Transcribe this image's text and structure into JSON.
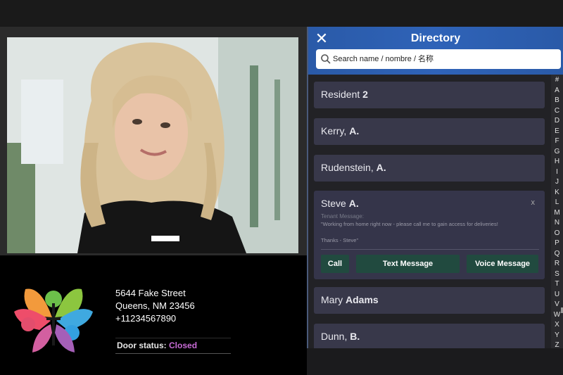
{
  "video": {
    "subject": "resident-camera-feed"
  },
  "info": {
    "address_line1": "5644 Fake Street",
    "address_line2": "Queens, NM 23456",
    "phone": "+11234567890",
    "door_status_label": "Door status:",
    "door_status_value": "Closed"
  },
  "directory": {
    "title": "Directory",
    "close_icon": "close-icon",
    "search_placeholder": "Search name / nombre / 名称",
    "entries": [
      {
        "first": "Resident ",
        "last": "2"
      },
      {
        "first": "Kerry, ",
        "last": "A."
      },
      {
        "first": "Rudenstein, ",
        "last": "A."
      },
      {
        "first": "Steve ",
        "last": "A."
      },
      {
        "first": "Mary ",
        "last": "Adams"
      },
      {
        "first": "Dunn, ",
        "last": "B."
      }
    ],
    "expanded": {
      "close": "x",
      "tenant_message_label": "Tenant Message:",
      "tenant_message": "\"Working from home right now - please call me to gain access for deliveries!",
      "signature": "Thanks - Steve\"",
      "call": "Call",
      "text": "Text Message",
      "voice": "Voice Message"
    },
    "alphabet": [
      "#",
      "A",
      "B",
      "C",
      "D",
      "E",
      "F",
      "G",
      "H",
      "I",
      "J",
      "K",
      "L",
      "M",
      "N",
      "O",
      "P",
      "Q",
      "R",
      "S",
      "T",
      "U",
      "V",
      "W",
      "X",
      "Y",
      "Z"
    ]
  },
  "colors": {
    "header": "#2f63b8",
    "card": "#38384a",
    "action": "#214a3f",
    "status_closed": "#c86bd6"
  }
}
